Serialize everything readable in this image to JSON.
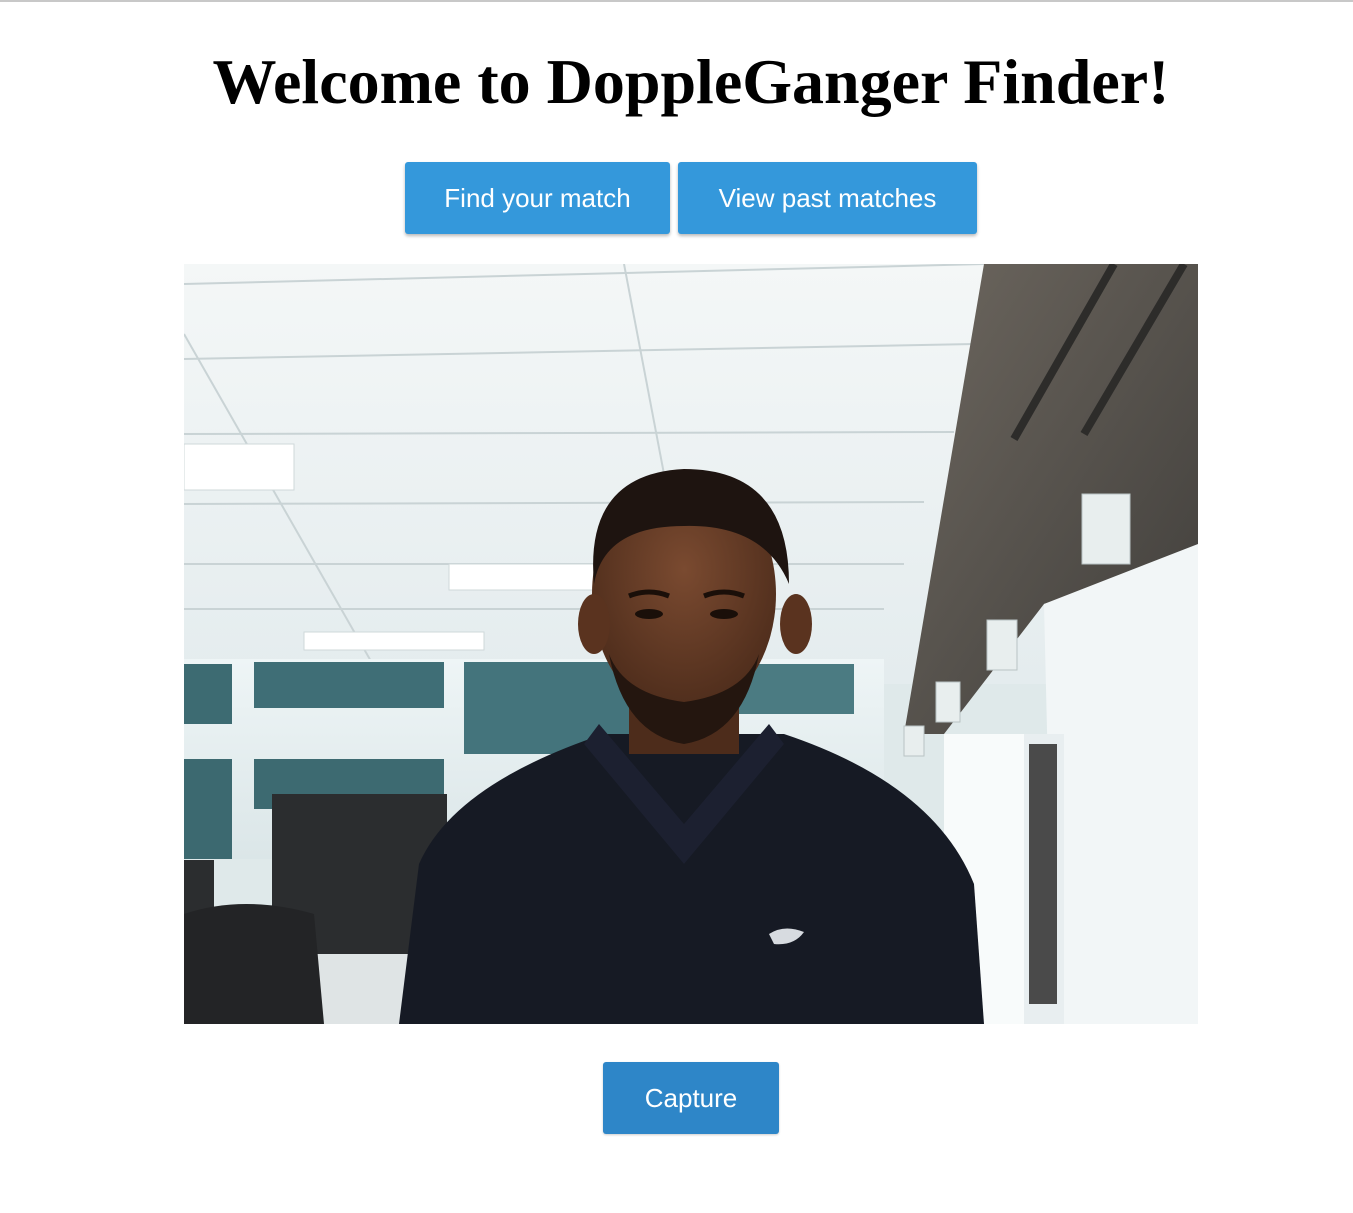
{
  "header": {
    "title": "Welcome to DoppleGanger Finder!"
  },
  "nav": {
    "find_match_label": "Find your match",
    "past_matches_label": "View past matches"
  },
  "camera": {
    "capture_label": "Capture"
  },
  "colors": {
    "button_primary": "#3498db",
    "button_capture": "#2e86c8",
    "background": "#ffffff",
    "title_text": "#000000"
  }
}
